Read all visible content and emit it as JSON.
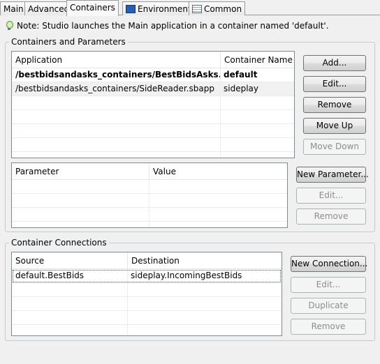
{
  "tabs": [
    {
      "label": "Main"
    },
    {
      "label": "Advanced"
    },
    {
      "label": "Containers"
    },
    {
      "label": "Environment"
    },
    {
      "label": "Common"
    }
  ],
  "note": "Note: Studio launches the Main application in a container named 'default'.",
  "containers_group": {
    "title": "Containers and Parameters",
    "app_table": {
      "headers": [
        "Application",
        "Container Name"
      ],
      "rows": [
        {
          "application": "/bestbidsandasks_containers/BestBidsAsks.sbapp",
          "container": "default"
        },
        {
          "application": "/bestbidsandasks_containers/SideReader.sbapp",
          "container": "sideplay"
        }
      ]
    },
    "buttons": {
      "add": "Add...",
      "edit": "Edit...",
      "remove": "Remove",
      "move_up": "Move Up",
      "move_down": "Move Down"
    },
    "param_table": {
      "headers": [
        "Parameter",
        "Value"
      ]
    },
    "param_buttons": {
      "new": "New Parameter...",
      "edit": "Edit...",
      "remove": "Remove"
    }
  },
  "connections_group": {
    "title": "Container Connections",
    "table": {
      "headers": [
        "Source",
        "Destination"
      ],
      "rows": [
        {
          "source": "default.BestBids",
          "destination": "sideplay.IncomingBestBids"
        }
      ]
    },
    "buttons": {
      "new": "New Connection...",
      "edit": "Edit...",
      "duplicate": "Duplicate",
      "remove": "Remove"
    }
  },
  "icons": {
    "note": "lightbulb-icon",
    "environment_tab": "environment-icon",
    "common_tab": "common-icon"
  }
}
